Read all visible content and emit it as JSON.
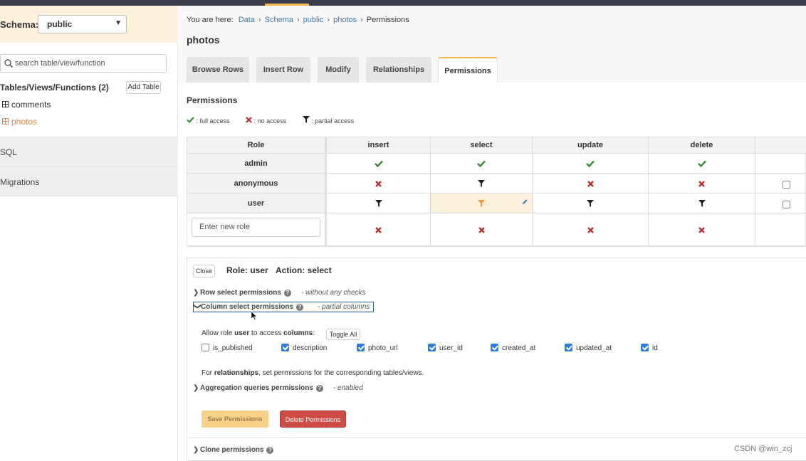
{
  "sidebar": {
    "schema_label": "Schema:",
    "schema_value": "public",
    "search_placeholder": "search table/view/function",
    "tables_heading": "Tables/Views/Functions (2)",
    "add_table_label": "Add Table",
    "tables": [
      {
        "name": "comments",
        "active": false
      },
      {
        "name": "photos",
        "active": true
      }
    ],
    "nav": [
      "SQL",
      "Migrations"
    ]
  },
  "header": {
    "breadcrumb_prefix": "You are here:",
    "breadcrumb": [
      "Data",
      "Schema",
      "public",
      "photos",
      "Permissions"
    ],
    "title": "photos"
  },
  "tabs": [
    {
      "label": "Browse Rows",
      "active": false
    },
    {
      "label": "Insert Row",
      "active": false
    },
    {
      "label": "Modify",
      "active": false
    },
    {
      "label": "Relationships",
      "active": false
    },
    {
      "label": "Permissions",
      "active": true
    }
  ],
  "permissions": {
    "section_title": "Permissions",
    "legend": {
      "full": ": full access",
      "none": ": no access",
      "partial": ": partial access"
    },
    "columns": [
      "Role",
      "insert",
      "select",
      "update",
      "delete"
    ],
    "rows": [
      {
        "role": "admin",
        "cells": [
          "full",
          "full",
          "full",
          "full"
        ],
        "has_checkbox": false
      },
      {
        "role": "anonymous",
        "cells": [
          "none",
          "partial",
          "none",
          "none"
        ],
        "has_checkbox": true
      },
      {
        "role": "user",
        "cells": [
          "partial",
          "partial",
          "partial",
          "partial"
        ],
        "has_checkbox": true,
        "selected_col": 1
      }
    ],
    "new_role_placeholder": "Enter new role",
    "new_role_cells": [
      "none",
      "none",
      "none",
      "none"
    ],
    "colors": {
      "full": "#3c8a3a",
      "none": "#b62f2f",
      "partial": "#222222",
      "partial_selected": "#f09a30",
      "selected_bg": "#fdf1dc"
    }
  },
  "editor": {
    "close_label": "Close",
    "role_text": "Role: user",
    "action_text": "Action: select",
    "row_select_label": "Row select permissions",
    "row_select_note": "- without any checks",
    "column_select_label": "Column select permissions",
    "column_select_note": "- partial columns",
    "allow_prefix": "Allow role ",
    "allow_role": "user",
    "allow_mid": " to access ",
    "allow_target": "columns",
    "allow_suffix": ":",
    "toggle_all_label": "Toggle All",
    "columns": [
      {
        "name": "is_published",
        "checked": false
      },
      {
        "name": "description",
        "checked": true
      },
      {
        "name": "photo_url",
        "checked": true
      },
      {
        "name": "user_id",
        "checked": true
      },
      {
        "name": "created_at",
        "checked": true
      },
      {
        "name": "updated_at",
        "checked": true
      },
      {
        "name": "id",
        "checked": true
      }
    ],
    "rel_prefix": "For ",
    "rel_bold": "relationships",
    "rel_suffix": ", set permissions for the corresponding tables/views.",
    "aggregation_label": "Aggregation queries permissions",
    "aggregation_note": "- enabled",
    "save_label": "Save Permissions",
    "delete_label": "Delete Permissions",
    "clone_label": "Clone permissions"
  },
  "watermark": "CSDN @win_zcj"
}
